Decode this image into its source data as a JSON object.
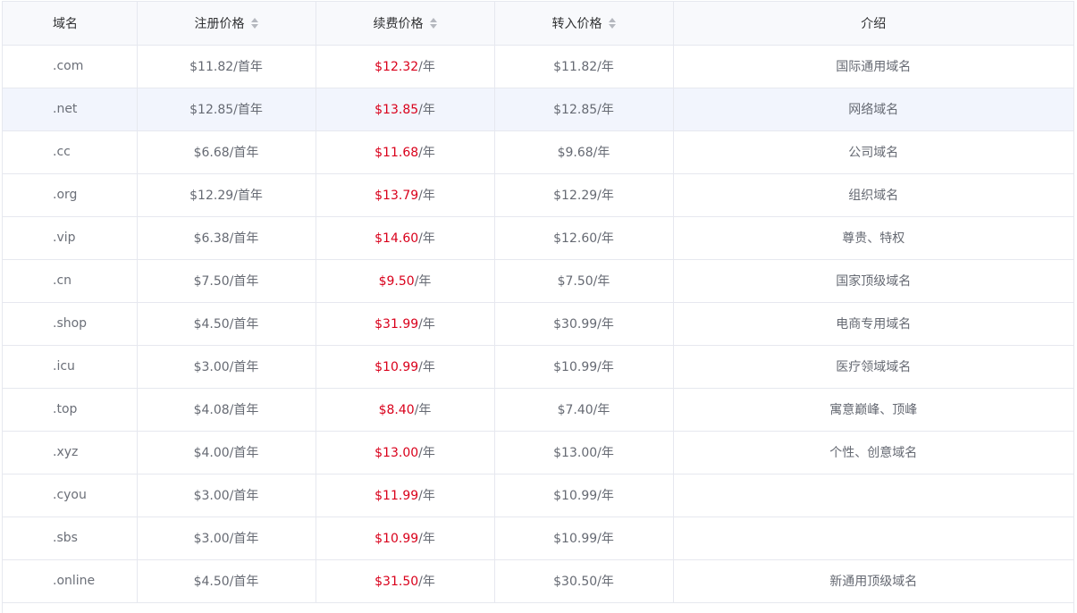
{
  "header": {
    "domain": "域名",
    "register": "注册价格",
    "renew": "续费价格",
    "transfer": "转入价格",
    "intro": "介绍"
  },
  "colors": {
    "renew_price": "#d9001b",
    "header_bg": "#f8f9fc",
    "hover_row_bg": "#f2f5fd"
  },
  "rows": [
    {
      "domain": ".com",
      "register": "$11.82/首年",
      "renew_price": "$12.32",
      "renew_unit": "/年",
      "transfer": "$11.82/年",
      "intro": "国际通用域名"
    },
    {
      "domain": ".net",
      "register": "$12.85/首年",
      "renew_price": "$13.85",
      "renew_unit": "/年",
      "transfer": "$12.85/年",
      "intro": "网络域名"
    },
    {
      "domain": ".cc",
      "register": "$6.68/首年",
      "renew_price": "$11.68",
      "renew_unit": "/年",
      "transfer": "$9.68/年",
      "intro": "公司域名"
    },
    {
      "domain": ".org",
      "register": "$12.29/首年",
      "renew_price": "$13.79",
      "renew_unit": "/年",
      "transfer": "$12.29/年",
      "intro": "组织域名"
    },
    {
      "domain": ".vip",
      "register": "$6.38/首年",
      "renew_price": "$14.60",
      "renew_unit": "/年",
      "transfer": "$12.60/年",
      "intro": "尊贵、特权"
    },
    {
      "domain": ".cn",
      "register": "$7.50/首年",
      "renew_price": "$9.50",
      "renew_unit": "/年",
      "transfer": "$7.50/年",
      "intro": "国家顶级域名"
    },
    {
      "domain": ".shop",
      "register": "$4.50/首年",
      "renew_price": "$31.99",
      "renew_unit": "/年",
      "transfer": "$30.99/年",
      "intro": "电商专用域名"
    },
    {
      "domain": ".icu",
      "register": "$3.00/首年",
      "renew_price": "$10.99",
      "renew_unit": "/年",
      "transfer": "$10.99/年",
      "intro": "医疗领域域名"
    },
    {
      "domain": ".top",
      "register": "$4.08/首年",
      "renew_price": "$8.40",
      "renew_unit": "/年",
      "transfer": "$7.40/年",
      "intro": "寓意巅峰、顶峰"
    },
    {
      "domain": ".xyz",
      "register": "$4.00/首年",
      "renew_price": "$13.00",
      "renew_unit": "/年",
      "transfer": "$13.00/年",
      "intro": "个性、创意域名"
    },
    {
      "domain": ".cyou",
      "register": "$3.00/首年",
      "renew_price": "$11.99",
      "renew_unit": "/年",
      "transfer": "$10.99/年",
      "intro": ""
    },
    {
      "domain": ".sbs",
      "register": "$3.00/首年",
      "renew_price": "$10.99",
      "renew_unit": "/年",
      "transfer": "$10.99/年",
      "intro": ""
    },
    {
      "domain": ".online",
      "register": "$4.50/首年",
      "renew_price": "$31.50",
      "renew_unit": "/年",
      "transfer": "$30.50/年",
      "intro": "新通用顶级域名"
    }
  ]
}
